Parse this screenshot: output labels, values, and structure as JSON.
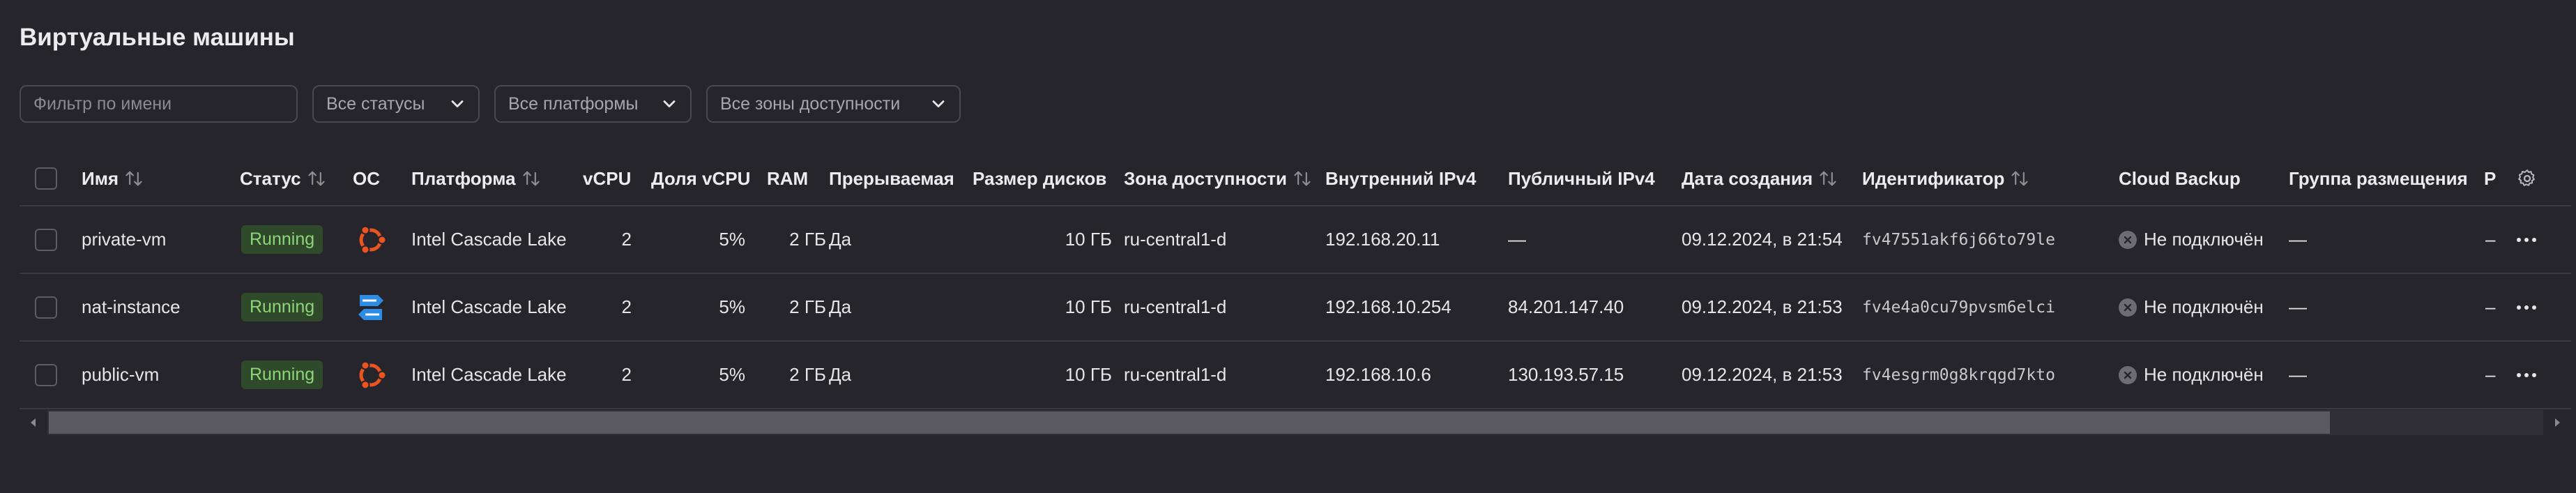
{
  "page": {
    "title": "Виртуальные машины"
  },
  "filters": {
    "name_placeholder": "Фильтр по имени",
    "status_select": "Все статусы",
    "platform_select": "Все платформы",
    "zone_select": "Все зоны доступности"
  },
  "table": {
    "columns": {
      "name": "Имя",
      "status": "Статус",
      "os": "ОС",
      "platform": "Платформа",
      "vcpu": "vCPU",
      "vcpu_share": "Доля vCPU",
      "ram": "RAM",
      "preemptible": "Прерываемая",
      "disk_size": "Размер дисков",
      "zone": "Зона доступности",
      "internal_ip": "Внутренний IPv4",
      "public_ip": "Публичный IPv4",
      "created": "Дата создания",
      "id": "Идентификатор",
      "backup": "Cloud Backup",
      "placement": "Группа размещения",
      "truncated": "Р"
    },
    "rows": [
      {
        "name": "private-vm",
        "status": "Running",
        "os_icon": "ubuntu-icon",
        "platform": "Intel Cascade Lake",
        "vcpu": "2",
        "vcpu_share": "5%",
        "ram": "2 ГБ",
        "preemptible": "Да",
        "disk_size": "10 ГБ",
        "zone": "ru-central1-d",
        "internal_ip": "192.168.20.11",
        "public_ip": "—",
        "created": "09.12.2024, в 21:54",
        "id": "fv47551akf6j66to79le",
        "backup": "Не подключён",
        "placement": "—",
        "truncated": "–"
      },
      {
        "name": "nat-instance",
        "status": "Running",
        "os_icon": "nat-instance-icon",
        "platform": "Intel Cascade Lake",
        "vcpu": "2",
        "vcpu_share": "5%",
        "ram": "2 ГБ",
        "preemptible": "Да",
        "disk_size": "10 ГБ",
        "zone": "ru-central1-d",
        "internal_ip": "192.168.10.254",
        "public_ip": "84.201.147.40",
        "created": "09.12.2024, в 21:53",
        "id": "fv4e4a0cu79pvsm6elci",
        "backup": "Не подключён",
        "placement": "—",
        "truncated": "–"
      },
      {
        "name": "public-vm",
        "status": "Running",
        "os_icon": "ubuntu-icon",
        "platform": "Intel Cascade Lake",
        "vcpu": "2",
        "vcpu_share": "5%",
        "ram": "2 ГБ",
        "preemptible": "Да",
        "disk_size": "10 ГБ",
        "zone": "ru-central1-d",
        "internal_ip": "192.168.10.6",
        "public_ip": "130.193.57.15",
        "created": "09.12.2024, в 21:53",
        "id": "fv4esgrm0g8krqgd7kto",
        "backup": "Не подключён",
        "placement": "—",
        "truncated": "–"
      }
    ]
  },
  "colors": {
    "background": "#26252b",
    "running_badge_bg": "#2f4a2a",
    "running_badge_text": "#8ed47a",
    "ubuntu_orange": "#e95420",
    "nat_blue": "#2d8ce6"
  }
}
